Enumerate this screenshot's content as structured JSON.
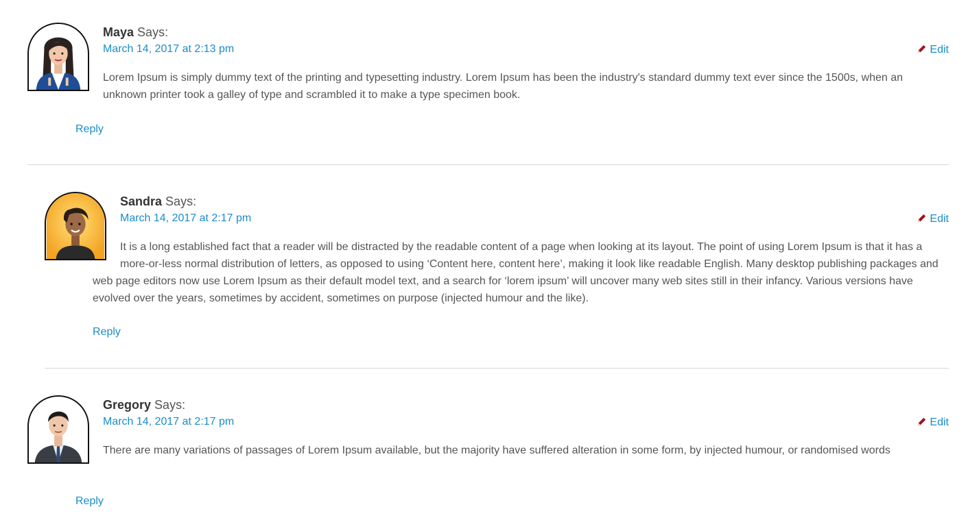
{
  "comments": [
    {
      "author": "Maya",
      "says": "Says:",
      "date": "March 14, 2017 at 2:13 pm",
      "edit": "Edit",
      "text": "Lorem Ipsum is simply dummy text of the printing and typesetting industry. Lorem Ipsum has been the industry's standard dummy text ever since the 1500s, when an unknown printer took a galley of type and scrambled it to make a type specimen book.",
      "reply": "Reply",
      "avatar": "woman-avatar-icon"
    },
    {
      "author": "Sandra",
      "says": "Says:",
      "date": "March 14, 2017 at 2:17 pm",
      "edit": "Edit",
      "text": "It is a long established fact that a reader will be distracted by the readable content of a page when looking at its layout. The point of using Lorem Ipsum is that it has a more-or-less normal distribution of letters, as opposed to using ‘Content here, content here’, making it look like readable English. Many desktop publishing packages and web page editors now use Lorem Ipsum as their default model text, and a search for ‘lorem ipsum’ will uncover many web sites still in their infancy. Various versions have evolved over the years, sometimes by accident, sometimes on purpose (injected humour and the like).",
      "reply": "Reply",
      "avatar": "woman-avatar-icon"
    },
    {
      "author": "Gregory",
      "says": "Says:",
      "date": "March 14, 2017 at 2:17 pm",
      "edit": "Edit",
      "text": "There are many variations of passages of Lorem Ipsum available, but the majority have suffered alteration in some form, by injected humour, or randomised words",
      "reply": "Reply",
      "avatar": "man-avatar-icon"
    }
  ],
  "colors": {
    "link": "#1a8dc9",
    "text": "#555555",
    "author": "#333333",
    "divider": "#d6d6d6",
    "pencil": "#a3101c"
  }
}
